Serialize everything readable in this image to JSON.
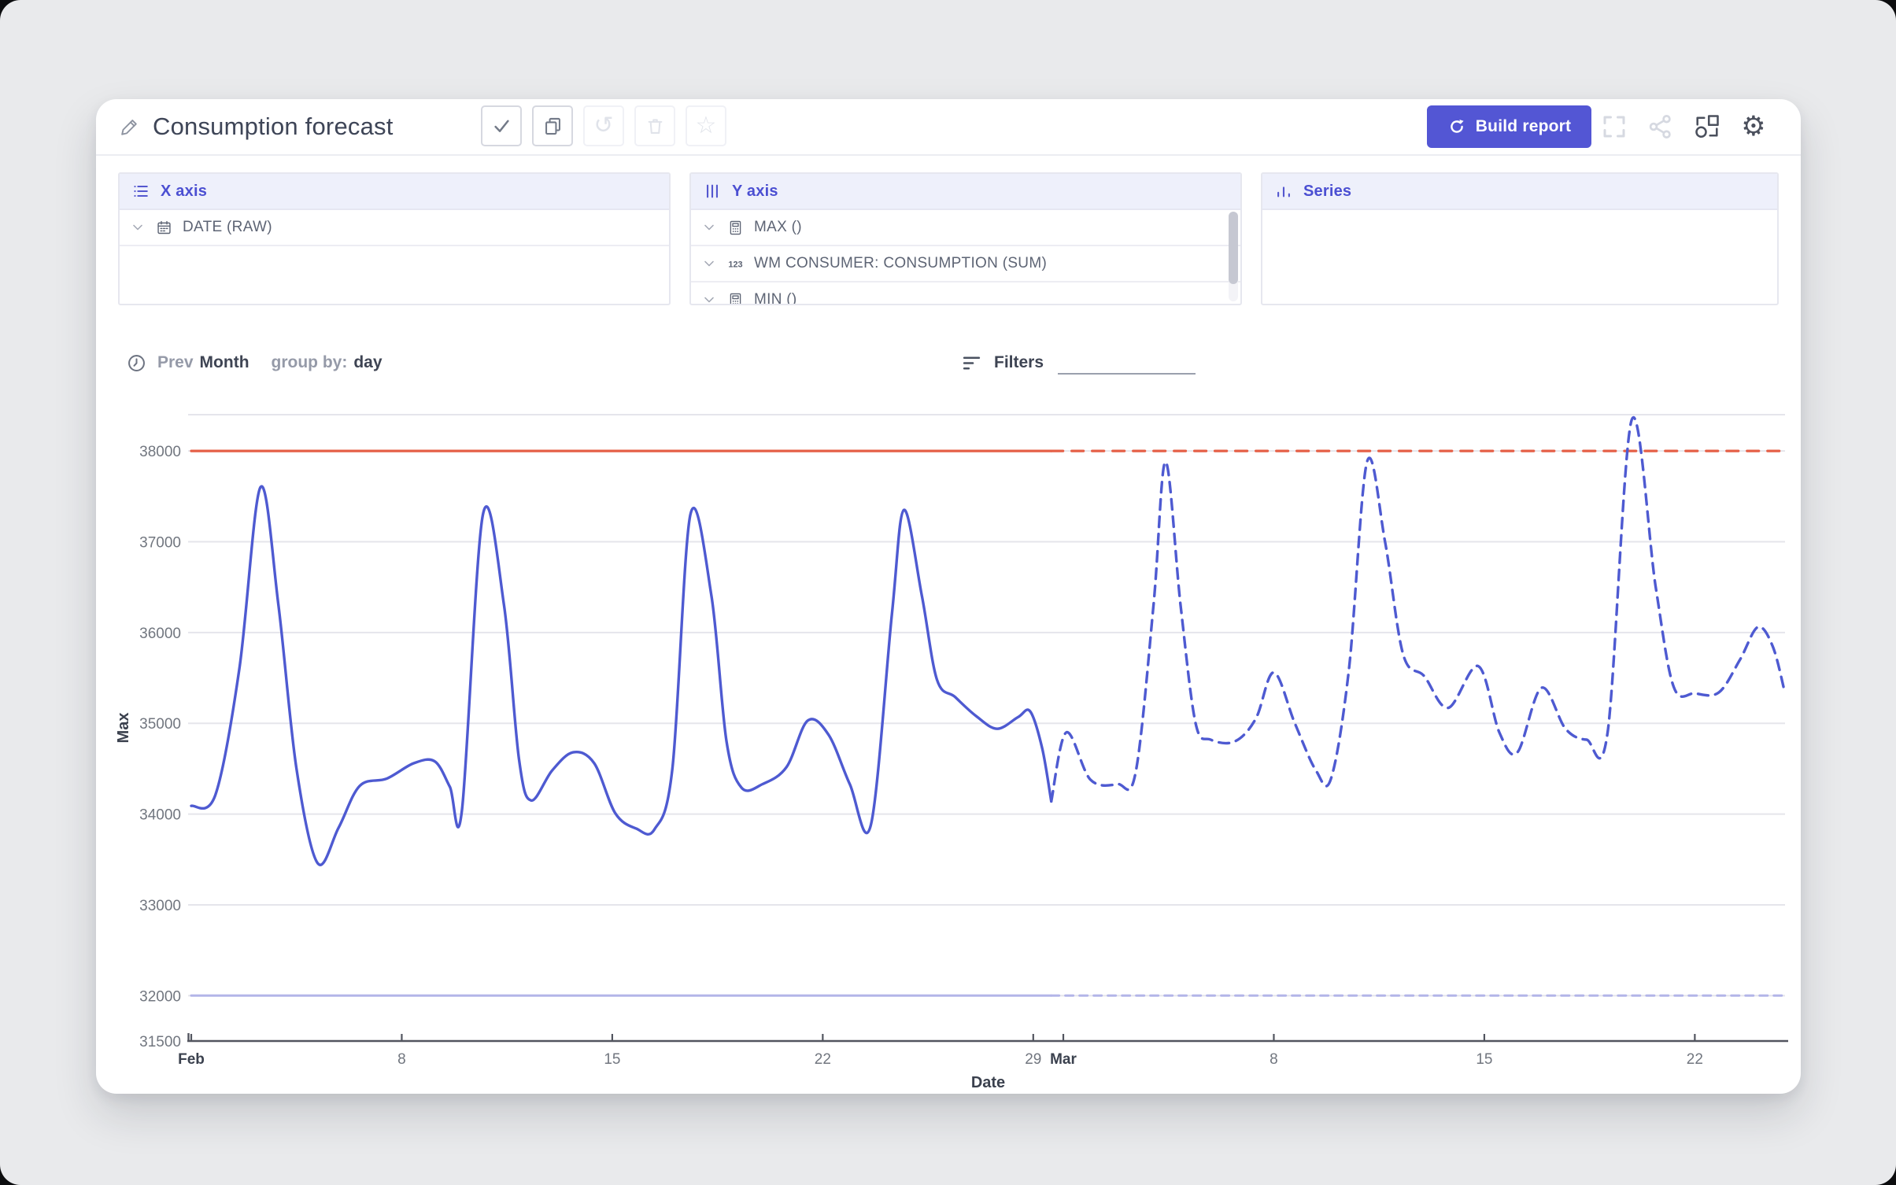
{
  "toolbar": {
    "title": "Consumption forecast",
    "build_report_label": "Build report",
    "actions": [
      {
        "name": "apply",
        "icon": "check-icon",
        "enabled": true
      },
      {
        "name": "duplicate",
        "icon": "copy-icon",
        "enabled": true
      },
      {
        "name": "undo",
        "icon": "undo-icon",
        "enabled": false
      },
      {
        "name": "delete",
        "icon": "trash-icon",
        "enabled": false
      },
      {
        "name": "favorite",
        "icon": "star-icon",
        "enabled": false
      }
    ],
    "right_icons": [
      {
        "name": "fullscreen-icon",
        "enabled": false
      },
      {
        "name": "share-icon",
        "enabled": false
      },
      {
        "name": "change-visualization-icon",
        "enabled": true
      },
      {
        "name": "settings-icon",
        "enabled": true
      }
    ]
  },
  "icons": {
    "title_edit": "pencil-icon",
    "period": "clock-icon",
    "filters": "filter-icon",
    "x_axis_header": "list-icon",
    "y_axis_header": "columns-icon",
    "series_header": "bar-chart-icon",
    "row_expand": "chevron-down-icon",
    "build_report": "refresh-icon"
  },
  "panels": {
    "x_axis": {
      "label": "X axis",
      "icon": "list-icon",
      "rows": [
        {
          "icon": "calendar-icon",
          "label": "DATE (RAW)"
        }
      ]
    },
    "y_axis": {
      "label": "Y axis",
      "icon": "columns-icon",
      "scrollbar": true,
      "rows": [
        {
          "icon": "calculator-icon",
          "label": "MAX ()"
        },
        {
          "icon": "123-icon",
          "label": "WM CONSUMER: CONSUMPTION (SUM)"
        },
        {
          "icon": "calculator-icon",
          "label": "MIN ()"
        }
      ]
    },
    "series": {
      "label": "Series",
      "icon": "bar-chart-icon",
      "rows": []
    }
  },
  "controls": {
    "period_prefix": "Prev",
    "period_value": "Month",
    "group_by_label": "group by:",
    "group_by_value": "day",
    "filters_label": "Filters"
  },
  "chart_data": {
    "type": "line",
    "xlabel": "Date",
    "ylabel": "Max",
    "x_unit": "days since Feb 1",
    "x_domain": [
      0,
      53
    ],
    "y_domain": [
      31500,
      38400
    ],
    "grid": true,
    "legend": "none",
    "y_gridlines": [
      32000,
      33000,
      34000,
      35000,
      36000,
      37000,
      38000,
      38400
    ],
    "y_ticks": [
      31500,
      32000,
      33000,
      34000,
      35000,
      36000,
      37000,
      38000
    ],
    "x_ticks": [
      {
        "d": 0,
        "label": "Feb",
        "bold": true
      },
      {
        "d": 7,
        "label": "8",
        "bold": false
      },
      {
        "d": 14,
        "label": "15",
        "bold": false
      },
      {
        "d": 21,
        "label": "22",
        "bold": false
      },
      {
        "d": 28,
        "label": "29",
        "bold": false
      },
      {
        "d": 29,
        "label": "Mar",
        "bold": true
      },
      {
        "d": 36,
        "label": "8",
        "bold": false
      },
      {
        "d": 43,
        "label": "15",
        "bold": false
      },
      {
        "d": 50,
        "label": "22",
        "bold": false
      }
    ],
    "colors": {
      "line": "#4e5ad1",
      "max_threshold": "#e55f46",
      "min_threshold": "#b3b5e8",
      "grid": "#e5e5eb",
      "axis": "#52555f",
      "tick_text": "#71767f",
      "bold_text": "#3b414e"
    },
    "series": [
      {
        "name": "max-threshold",
        "segment": "actual",
        "color": "#e55f46",
        "width": 3.2,
        "dash": null,
        "points": [
          [
            0,
            38000
          ],
          [
            28.6,
            38000
          ]
        ]
      },
      {
        "name": "max-threshold",
        "segment": "forecast",
        "color": "#e55f46",
        "width": 3.2,
        "dash": "15 11",
        "points": [
          [
            28.6,
            38000
          ],
          [
            53,
            38000
          ]
        ]
      },
      {
        "name": "min-threshold",
        "segment": "actual",
        "color": "#b3b5e8",
        "width": 3,
        "dash": null,
        "points": [
          [
            0,
            32000
          ],
          [
            28.6,
            32000
          ]
        ]
      },
      {
        "name": "min-threshold",
        "segment": "forecast",
        "color": "#b3b5e8",
        "width": 3,
        "dash": "10 8",
        "points": [
          [
            28.6,
            32000
          ],
          [
            53,
            32000
          ]
        ]
      },
      {
        "name": "consumption-max",
        "segment": "actual",
        "color": "#4e5ad1",
        "width": 3.4,
        "dash": null,
        "points": [
          [
            0,
            34090
          ],
          [
            0.8,
            34210
          ],
          [
            1.6,
            35600
          ],
          [
            2.3,
            37600
          ],
          [
            2.9,
            36300
          ],
          [
            3.5,
            34500
          ],
          [
            4.2,
            33460
          ],
          [
            4.9,
            33850
          ],
          [
            5.6,
            34310
          ],
          [
            6.5,
            34390
          ],
          [
            7.4,
            34560
          ],
          [
            8.1,
            34580
          ],
          [
            8.6,
            34300
          ],
          [
            9.0,
            34040
          ],
          [
            9.7,
            37300
          ],
          [
            10.4,
            36300
          ],
          [
            10.9,
            34600
          ],
          [
            11.3,
            34150
          ],
          [
            12.0,
            34480
          ],
          [
            12.7,
            34680
          ],
          [
            13.4,
            34560
          ],
          [
            14.1,
            34010
          ],
          [
            14.8,
            33840
          ],
          [
            15.4,
            33830
          ],
          [
            16.0,
            34500
          ],
          [
            16.6,
            37300
          ],
          [
            17.3,
            36400
          ],
          [
            17.8,
            34800
          ],
          [
            18.3,
            34290
          ],
          [
            19.0,
            34330
          ],
          [
            19.8,
            34520
          ],
          [
            20.5,
            35030
          ],
          [
            21.2,
            34870
          ],
          [
            21.9,
            34330
          ],
          [
            22.6,
            33880
          ],
          [
            23.3,
            36200
          ],
          [
            23.7,
            37350
          ],
          [
            24.3,
            36400
          ],
          [
            24.8,
            35480
          ],
          [
            25.4,
            35290
          ],
          [
            26.1,
            35080
          ],
          [
            26.8,
            34940
          ],
          [
            27.5,
            35070
          ],
          [
            27.9,
            35130
          ],
          [
            28.3,
            34720
          ],
          [
            28.6,
            34140
          ]
        ]
      },
      {
        "name": "consumption-max",
        "segment": "forecast",
        "color": "#4e5ad1",
        "width": 3.4,
        "dash": "13 9",
        "points": [
          [
            28.6,
            34140
          ],
          [
            29.1,
            34900
          ],
          [
            29.9,
            34380
          ],
          [
            30.8,
            34330
          ],
          [
            31.4,
            34450
          ],
          [
            32.0,
            36300
          ],
          [
            32.4,
            37880
          ],
          [
            32.9,
            36300
          ],
          [
            33.4,
            35000
          ],
          [
            33.9,
            34820
          ],
          [
            34.7,
            34800
          ],
          [
            35.4,
            35050
          ],
          [
            36.0,
            35560
          ],
          [
            36.7,
            35000
          ],
          [
            37.4,
            34480
          ],
          [
            37.9,
            34390
          ],
          [
            38.5,
            35600
          ],
          [
            39.1,
            37880
          ],
          [
            39.7,
            37000
          ],
          [
            40.3,
            35760
          ],
          [
            41.0,
            35520
          ],
          [
            41.8,
            35170
          ],
          [
            42.8,
            35630
          ],
          [
            43.5,
            34900
          ],
          [
            44.1,
            34680
          ],
          [
            44.9,
            35390
          ],
          [
            45.7,
            34940
          ],
          [
            46.4,
            34820
          ],
          [
            47.1,
            34900
          ],
          [
            47.9,
            38340
          ],
          [
            48.7,
            36500
          ],
          [
            49.3,
            35400
          ],
          [
            50.0,
            35330
          ],
          [
            50.8,
            35340
          ],
          [
            51.5,
            35700
          ],
          [
            52.1,
            36060
          ],
          [
            52.6,
            35840
          ],
          [
            53.0,
            35330
          ]
        ]
      }
    ]
  }
}
